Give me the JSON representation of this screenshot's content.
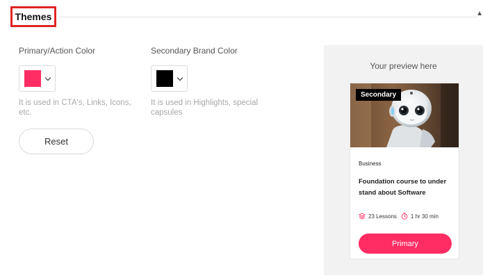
{
  "section": {
    "title": "Themes"
  },
  "primary_color": {
    "label": "Primary/Action Color",
    "value": "#ff2d63",
    "helper": "It is used in CTA's, Links, Icons, etc."
  },
  "secondary_color": {
    "label": "Secondary Brand Color",
    "value": "#000000",
    "helper": "It is used in Highlights, special capsules"
  },
  "reset_label": "Reset",
  "preview": {
    "title": "Your preview here",
    "card": {
      "badge": "Secondary",
      "category": "Business",
      "title": "Foundation course to under stand about Software",
      "lessons": "23 Lessons",
      "duration": "1 hr 30 min",
      "button_label": "Primary",
      "image_icon": "robot-image"
    }
  },
  "colors": {
    "accent": "#ff2d63",
    "highlight_box": "#e02424",
    "panel_bg": "#f2f2f2"
  }
}
